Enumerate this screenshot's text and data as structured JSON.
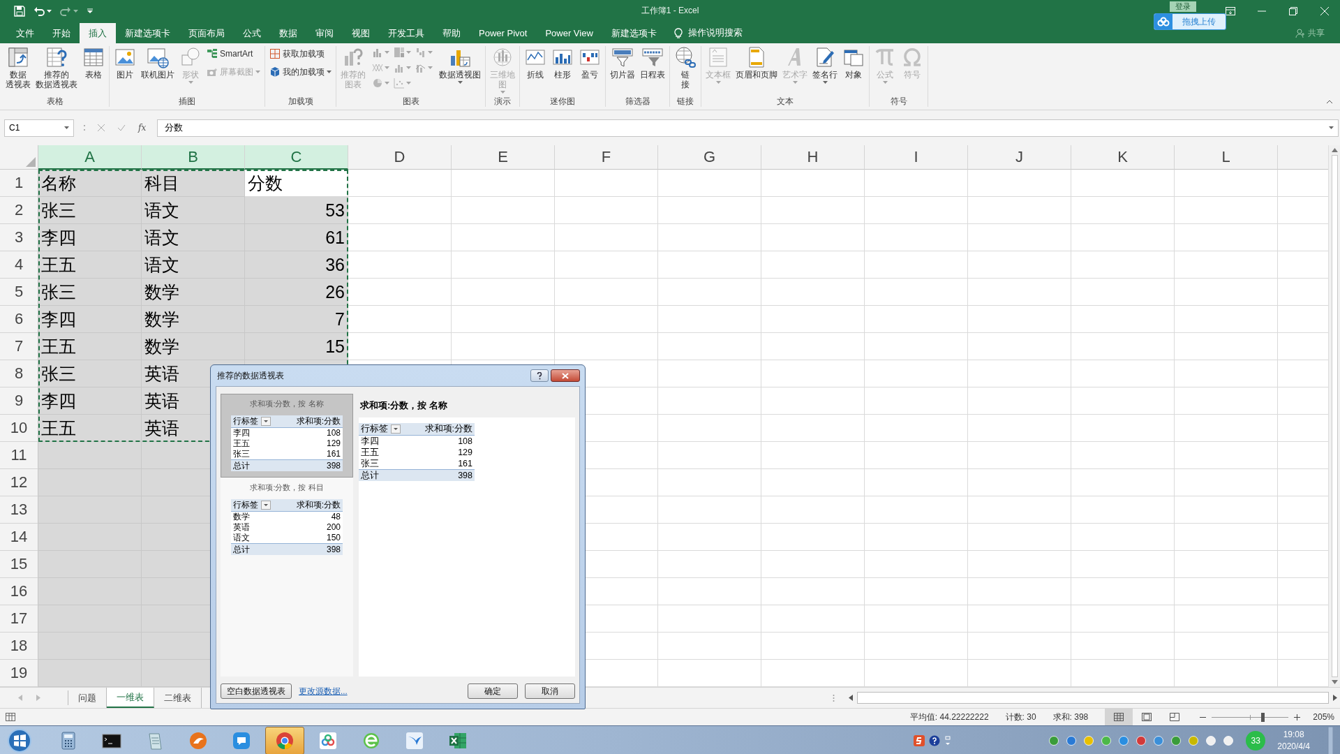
{
  "window": {
    "title": "工作簿1  -  Excel",
    "login": "登录",
    "upload": "拖拽上传",
    "share": "共享"
  },
  "ribbon_tabs": [
    {
      "label": "文件",
      "selected": false
    },
    {
      "label": "开始",
      "selected": false
    },
    {
      "label": "插入",
      "selected": true
    },
    {
      "label": "新建选项卡",
      "selected": false
    },
    {
      "label": "页面布局",
      "selected": false
    },
    {
      "label": "公式",
      "selected": false
    },
    {
      "label": "数据",
      "selected": false
    },
    {
      "label": "审阅",
      "selected": false
    },
    {
      "label": "视图",
      "selected": false
    },
    {
      "label": "开发工具",
      "selected": false
    },
    {
      "label": "帮助",
      "selected": false
    },
    {
      "label": "Power Pivot",
      "selected": false
    },
    {
      "label": "Power View",
      "selected": false
    },
    {
      "label": "新建选项卡",
      "selected": false
    }
  ],
  "tell_me": "操作说明搜索",
  "ribbon_groups": [
    {
      "label": "表格",
      "items": [
        {
          "kind": "large",
          "lines": [
            "数据",
            "透视表"
          ],
          "disabled": false
        },
        {
          "kind": "large",
          "lines": [
            "推荐的",
            "数据透视表"
          ],
          "disabled": false
        },
        {
          "kind": "large",
          "lines": [
            "表格"
          ],
          "disabled": false
        }
      ]
    },
    {
      "label": "插图",
      "items": [
        {
          "kind": "large",
          "lines": [
            "图片"
          ],
          "disabled": false
        },
        {
          "kind": "large",
          "lines": [
            "联机图片"
          ],
          "disabled": false
        },
        {
          "kind": "large",
          "lines": [
            "形状"
          ],
          "disabled": true,
          "dropdown": true
        },
        {
          "kind": "small",
          "lines": [
            "SmartArt"
          ],
          "disabled": false
        },
        {
          "kind": "small",
          "lines": [
            "屏幕截图"
          ],
          "disabled": true,
          "dropdown": true
        }
      ]
    },
    {
      "label": "加载项",
      "items": [
        {
          "kind": "small",
          "lines": [
            "获取加载项"
          ],
          "disabled": false
        },
        {
          "kind": "small",
          "lines": [
            "我的加载项"
          ],
          "disabled": false,
          "dropdown": true
        }
      ]
    },
    {
      "label": "图表",
      "items": [
        {
          "kind": "large",
          "lines": [
            "推荐的",
            "图表"
          ],
          "disabled": true
        },
        {
          "kind": "chart-icons",
          "disabled": true
        },
        {
          "kind": "large",
          "lines": [
            "数据透视图"
          ],
          "disabled": false,
          "dropdown": true
        }
      ]
    },
    {
      "label": "演示",
      "items": [
        {
          "kind": "large",
          "lines": [
            "三维地",
            "图"
          ],
          "disabled": true,
          "dropdown": true
        }
      ]
    },
    {
      "label": "迷你图",
      "items": [
        {
          "kind": "large",
          "lines": [
            "折线"
          ],
          "disabled": false
        },
        {
          "kind": "large",
          "lines": [
            "柱形"
          ],
          "disabled": false
        },
        {
          "kind": "large",
          "lines": [
            "盈亏"
          ],
          "disabled": false
        }
      ]
    },
    {
      "label": "筛选器",
      "items": [
        {
          "kind": "large",
          "lines": [
            "切片器"
          ],
          "disabled": false
        },
        {
          "kind": "large",
          "lines": [
            "日程表"
          ],
          "disabled": false
        }
      ]
    },
    {
      "label": "链接",
      "items": [
        {
          "kind": "large",
          "lines": [
            "链",
            "接"
          ],
          "disabled": false
        }
      ]
    },
    {
      "label": "文本",
      "items": [
        {
          "kind": "large",
          "lines": [
            "文本框"
          ],
          "disabled": true,
          "dropdown": true
        },
        {
          "kind": "large",
          "lines": [
            "页眉和页脚"
          ],
          "disabled": false
        },
        {
          "kind": "large",
          "lines": [
            "艺术字"
          ],
          "disabled": true,
          "dropdown": true
        },
        {
          "kind": "large",
          "lines": [
            "签名行"
          ],
          "disabled": false,
          "dropdown": true
        },
        {
          "kind": "large",
          "lines": [
            "对象"
          ],
          "disabled": false
        }
      ]
    },
    {
      "label": "符号",
      "items": [
        {
          "kind": "large",
          "lines": [
            "公式"
          ],
          "disabled": true,
          "dropdown": true
        },
        {
          "kind": "large",
          "lines": [
            "符号"
          ],
          "disabled": true
        }
      ]
    }
  ],
  "formula_bar": {
    "name_box": "C1",
    "function_label": "fx",
    "value": "分数"
  },
  "sheet": {
    "copy_marquee": true,
    "columns": [
      {
        "label": "A",
        "selected": true
      },
      {
        "label": "B",
        "selected": true
      },
      {
        "label": "C",
        "selected": true
      },
      {
        "label": "D",
        "selected": false
      },
      {
        "label": "E",
        "selected": false
      },
      {
        "label": "F",
        "selected": false
      },
      {
        "label": "G",
        "selected": false
      },
      {
        "label": "H",
        "selected": false
      },
      {
        "label": "I",
        "selected": false
      },
      {
        "label": "J",
        "selected": false
      },
      {
        "label": "K",
        "selected": false
      },
      {
        "label": "L",
        "selected": false
      }
    ],
    "rows": [
      {
        "label": "1",
        "cells": [
          {
            "text": "名称",
            "kind": "text",
            "active": false
          },
          {
            "text": "科目",
            "kind": "text",
            "active": false
          },
          {
            "text": "分数",
            "kind": "text",
            "active": true
          }
        ]
      },
      {
        "label": "2",
        "cells": [
          {
            "text": "张三",
            "kind": "text",
            "active": false
          },
          {
            "text": "语文",
            "kind": "text",
            "active": false
          },
          {
            "text": "53",
            "kind": "number",
            "active": false
          }
        ]
      },
      {
        "label": "3",
        "cells": [
          {
            "text": "李四",
            "kind": "text",
            "active": false
          },
          {
            "text": "语文",
            "kind": "text",
            "active": false
          },
          {
            "text": "61",
            "kind": "number",
            "active": false
          }
        ]
      },
      {
        "label": "4",
        "cells": [
          {
            "text": "王五",
            "kind": "text",
            "active": false
          },
          {
            "text": "语文",
            "kind": "text",
            "active": false
          },
          {
            "text": "36",
            "kind": "number",
            "active": false
          }
        ]
      },
      {
        "label": "5",
        "cells": [
          {
            "text": "张三",
            "kind": "text",
            "active": false
          },
          {
            "text": "数学",
            "kind": "text",
            "active": false
          },
          {
            "text": "26",
            "kind": "number",
            "active": false
          }
        ]
      },
      {
        "label": "6",
        "cells": [
          {
            "text": "李四",
            "kind": "text",
            "active": false
          },
          {
            "text": "数学",
            "kind": "text",
            "active": false
          },
          {
            "text": "7",
            "kind": "number",
            "active": false
          }
        ]
      },
      {
        "label": "7",
        "cells": [
          {
            "text": "王五",
            "kind": "text",
            "active": false
          },
          {
            "text": "数学",
            "kind": "text",
            "active": false
          },
          {
            "text": "15",
            "kind": "number",
            "active": false
          }
        ]
      },
      {
        "label": "8",
        "cells": [
          {
            "text": "张三",
            "kind": "text",
            "active": false
          },
          {
            "text": "英语",
            "kind": "text",
            "active": false
          }
        ]
      },
      {
        "label": "9",
        "cells": [
          {
            "text": "李四",
            "kind": "text",
            "active": false
          },
          {
            "text": "英语",
            "kind": "text",
            "active": false
          }
        ]
      },
      {
        "label": "10",
        "cells": [
          {
            "text": "王五",
            "kind": "text",
            "active": false
          },
          {
            "text": "英语",
            "kind": "text",
            "active": false
          }
        ]
      },
      {
        "label": "11"
      },
      {
        "label": "12"
      },
      {
        "label": "13"
      },
      {
        "label": "14"
      },
      {
        "label": "15"
      },
      {
        "label": "16"
      },
      {
        "label": "17"
      },
      {
        "label": "18"
      },
      {
        "label": "19"
      }
    ]
  },
  "sheet_tabs": [
    {
      "label": "问题",
      "selected": false
    },
    {
      "label": "一维表",
      "selected": true
    },
    {
      "label": "二维表",
      "selected": false
    }
  ],
  "status_bar": {
    "average": "平均值: 44.22222222",
    "count": "计数: 30",
    "sum": "求和: 398",
    "views": [
      {
        "selected": true
      },
      {
        "selected": false
      },
      {
        "selected": false
      }
    ],
    "zoom_slider": {
      "level": 0.66
    },
    "zoom": "205%"
  },
  "dialog": {
    "title": "推荐的数据透视表",
    "previews": [
      {
        "caption": "求和项:分数，按  名称",
        "selected": true,
        "header": [
          "行标签",
          "求和项:分数"
        ],
        "rows": [
          [
            "李四",
            "108"
          ],
          [
            "王五",
            "129"
          ],
          [
            "张三",
            "161"
          ]
        ],
        "total": [
          "总计",
          "398"
        ]
      },
      {
        "caption": "求和项:分数，按  科目",
        "selected": false,
        "header": [
          "行标签",
          "求和项:分数"
        ],
        "rows": [
          [
            "数学",
            "48"
          ],
          [
            "英语",
            "200"
          ],
          [
            "语文",
            "150"
          ]
        ],
        "total": [
          "总计",
          "398"
        ]
      }
    ],
    "detail": {
      "title": "求和项:分数，按  名称",
      "header": [
        "行标签",
        "求和项:分数"
      ],
      "rows": [
        [
          "李四",
          "108"
        ],
        [
          "王五",
          "129"
        ],
        [
          "张三",
          "161"
        ]
      ],
      "total": [
        "总计",
        "398"
      ]
    },
    "blank_button": "空白数据透视表",
    "change_source": "更改源数据...",
    "ok": "确定",
    "cancel": "取消"
  },
  "taskbar": {
    "apps": [
      {
        "selected": false
      },
      {
        "selected": false
      },
      {
        "selected": false
      },
      {
        "selected": false
      },
      {
        "selected": false
      },
      {
        "selected": true
      },
      {
        "selected": false
      },
      {
        "selected": false
      },
      {
        "selected": false
      },
      {
        "selected": false
      }
    ],
    "badge": "33",
    "time": "19:08",
    "date": "2020/4/4"
  }
}
